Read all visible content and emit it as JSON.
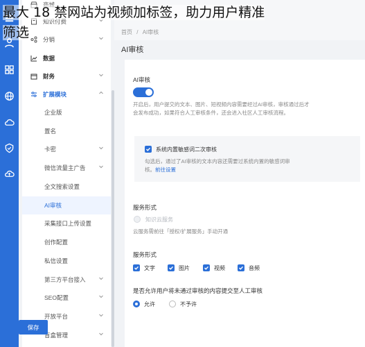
{
  "overlay": {
    "line1": "最大 18 禁网站为视频加标签，助力用户精准",
    "line2": "筛选"
  },
  "sidebar": {
    "items": [
      {
        "label": "商城"
      },
      {
        "label": "知识付费"
      },
      {
        "label": "分销"
      },
      {
        "label": "数据"
      },
      {
        "label": "财务"
      },
      {
        "label": "扩展模块"
      },
      {
        "label": "企业版"
      },
      {
        "label": "置名"
      },
      {
        "label": "卡密"
      },
      {
        "label": "微信流量主广告"
      },
      {
        "label": "全文搜索设置"
      },
      {
        "label": "AI审核"
      },
      {
        "label": "采集接口上传设置"
      },
      {
        "label": "创作配置"
      },
      {
        "label": "私信设置"
      },
      {
        "label": "第三方平台接入"
      },
      {
        "label": "SEO配置"
      },
      {
        "label": "开放平台"
      },
      {
        "label": "盲盒管理"
      }
    ]
  },
  "breadcrumb": {
    "home": "首页",
    "sep": "/",
    "current": "AI审核"
  },
  "page": {
    "title": "AI审核"
  },
  "audit": {
    "title": "AI审核",
    "toggle_on": true,
    "desc1": "开启后，用户提交的文本、图片、短视频内容需要经过AI审核，审核通过后才",
    "desc2": "会发布成功，如果符合人工审核条件，还会进入社区人工审核流程。"
  },
  "sensitive": {
    "label": "系统内置敏感词二次审核",
    "desc1": "勾选后，通过了AI审核的文本内容还需要过系统内置的敏感词审",
    "desc2_prefix": "核。",
    "link": "前往设置"
  },
  "service": {
    "title": "服务形式",
    "option": "知识云服务",
    "hint": "云服务需前往「授权/扩展服务」手动开通"
  },
  "types": {
    "title": "服务形式",
    "options": [
      "文字",
      "图片",
      "视频",
      "音频"
    ]
  },
  "manual": {
    "title": "是否允许用户将未通过审核的内容提交至人工审核",
    "allow": "允许",
    "deny": "不予许"
  },
  "save_label": "保存",
  "colors": {
    "accent": "#2b6fd8",
    "rail": "#2b6fd8"
  }
}
